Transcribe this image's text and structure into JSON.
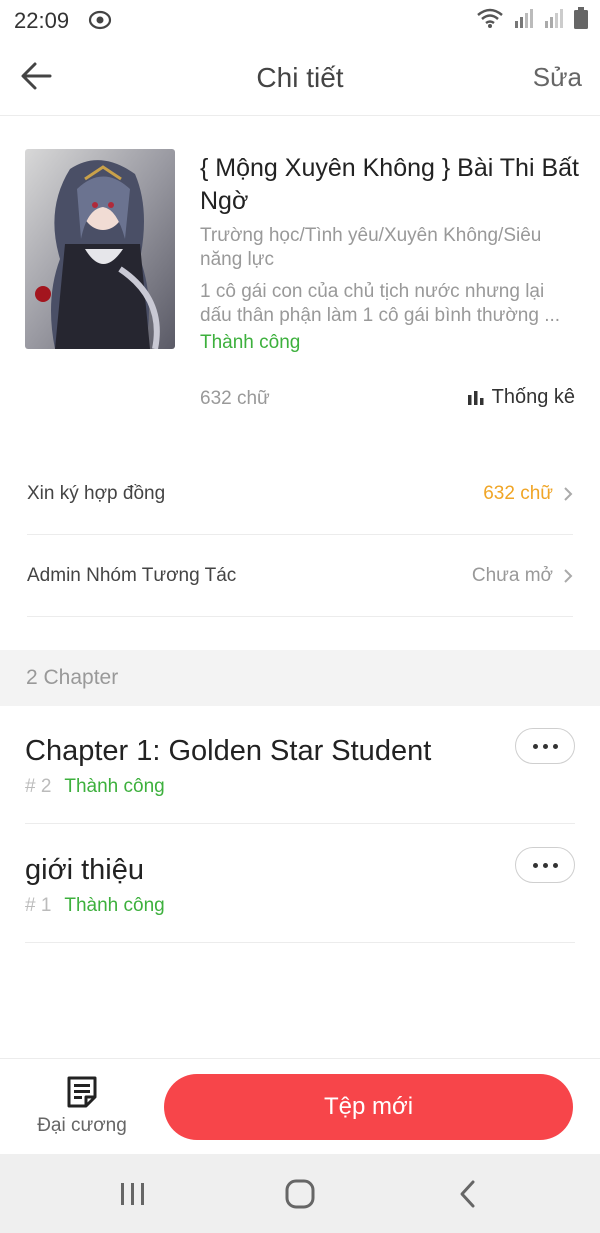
{
  "status_bar": {
    "time": "22:09"
  },
  "header": {
    "title": "Chi tiết",
    "edit_label": "Sửa"
  },
  "book": {
    "title": "{ Mộng Xuyên Không } Bài Thi Bất Ngờ",
    "genres": "Trường học/Tình yêu/Xuyên Không/Siêu năng lực",
    "description": "1 cô gái con của chủ tịch nước nhưng lại dấu thân phận làm 1 cô gái bình thường ...",
    "status": "Thành công",
    "word_count": "632 chữ",
    "stats_label": "Thống kê"
  },
  "rows": [
    {
      "label": "Xin ký hợp đồng",
      "value": "632 chữ"
    },
    {
      "label": "Admin Nhóm Tương Tác",
      "value": "Chưa mở"
    }
  ],
  "chapters_header": "2 Chapter",
  "chapters": [
    {
      "title": "Chapter 1: Golden Star Student",
      "number": "# 2",
      "status": "Thành công"
    },
    {
      "title": "giới thiệu",
      "number": "# 1",
      "status": "Thành công"
    }
  ],
  "bottom": {
    "outline_label": "Đại cương",
    "new_label": "Tệp mới"
  },
  "colors": {
    "accent_red": "#f7454a",
    "success_green": "#3db03d",
    "warning_orange": "#f0a526"
  },
  "icons": [
    "back-arrow-icon",
    "bar-chart-icon",
    "chevron-right-icon",
    "more-dots-icon",
    "outline-document-icon",
    "recent-apps-icon",
    "home-icon",
    "nav-back-icon",
    "wifi-icon",
    "signal-icon",
    "battery-icon"
  ]
}
